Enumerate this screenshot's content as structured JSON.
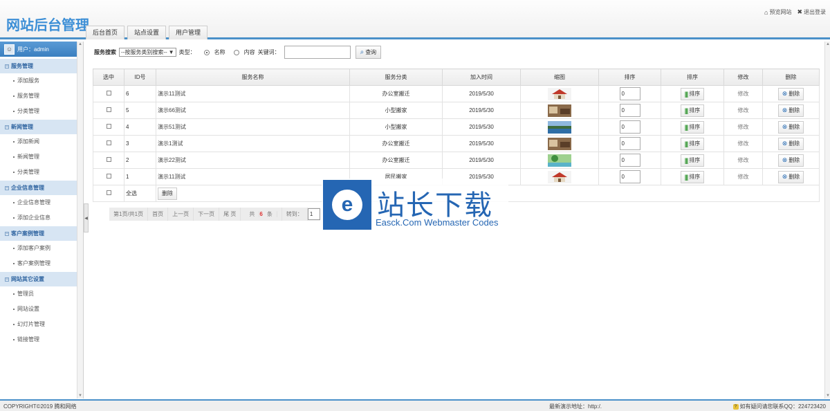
{
  "header": {
    "logo": "网站后台管理",
    "preview_site": "预览网站",
    "logout": "退出登录",
    "tabs": [
      "后台首页",
      "站点设置",
      "用户管理"
    ]
  },
  "sidebar": {
    "user_label": "用户：admin",
    "groups": [
      {
        "title": "服务管理",
        "items": [
          "添加服务",
          "服务管理",
          "分类管理"
        ]
      },
      {
        "title": "新闻管理",
        "items": [
          "添加新闻",
          "新闻管理",
          "分类管理"
        ]
      },
      {
        "title": "企业信息管理",
        "items": [
          "企业信息管理",
          "添加企业信息"
        ]
      },
      {
        "title": "客户案例管理",
        "items": [
          "添加客户案例",
          "客户案例管理"
        ]
      },
      {
        "title": "网站其它设置",
        "items": [
          "管理员",
          "网站设置",
          "幻灯片管理",
          "链接管理"
        ]
      }
    ]
  },
  "search": {
    "label": "服务搜索",
    "category_select": "--按服务类别搜索--",
    "type_label": "类型：",
    "opt_name": "名称",
    "opt_content": "内容",
    "keyword_label": "关键词：",
    "keyword_value": "",
    "query_button": "查询"
  },
  "table": {
    "headers": [
      "选中",
      "ID号",
      "服务名称",
      "服务分类",
      "加入时间",
      "缩图",
      "排序",
      "排序",
      "修改",
      "删除"
    ],
    "rows": [
      {
        "id": "6",
        "name": "演示11测试",
        "category": "办公室搬迁",
        "date": "2019/5/30",
        "thumb": "house-thumb",
        "sort": "0",
        "sort_btn": "排序",
        "edit": "修改",
        "delete": "删除"
      },
      {
        "id": "5",
        "name": "演示66测试",
        "category": "小型搬家",
        "date": "2019/5/30",
        "thumb": "room-thumb",
        "sort": "0",
        "sort_btn": "排序",
        "edit": "修改",
        "delete": "删除"
      },
      {
        "id": "4",
        "name": "演示51测试",
        "category": "小型搬家",
        "date": "2019/5/30",
        "thumb": "lake-thumb",
        "sort": "0",
        "sort_btn": "排序",
        "edit": "修改",
        "delete": "删除"
      },
      {
        "id": "3",
        "name": "演示1测试",
        "category": "办公室搬迁",
        "date": "2019/5/30",
        "thumb": "room-thumb",
        "sort": "0",
        "sort_btn": "排序",
        "edit": "修改",
        "delete": "删除"
      },
      {
        "id": "2",
        "name": "演示22测试",
        "category": "办公室搬迁",
        "date": "2019/5/30",
        "thumb": "nature-thumb",
        "sort": "0",
        "sort_btn": "排序",
        "edit": "修改",
        "delete": "删除"
      },
      {
        "id": "1",
        "name": "演示11测试",
        "category": "居民搬家",
        "date": "2019/5/30",
        "thumb": "house-thumb",
        "sort": "0",
        "sort_btn": "排序",
        "edit": "修改",
        "delete": "删除"
      }
    ],
    "select_all": "全选",
    "bulk_delete": "删除"
  },
  "pager": {
    "page_info": "第1页/共1页",
    "first": "首页",
    "prev": "上一页",
    "next": "下一页",
    "last": "尾 页",
    "total_prefix": "共",
    "total_count": "6",
    "total_suffix": "条",
    "jump_label": "转到：",
    "jump_value": "1"
  },
  "watermark": {
    "cn": "站长下载",
    "en": "Easck.Com Webmaster Codes",
    "logo_letter": "e"
  },
  "footer": {
    "copyright": "COPYRIGHT©2019 腾和网络",
    "demo": "最新演示地址：http:/.",
    "contact": "如有疑问请您联系QQ：224723420"
  },
  "colors": {
    "accent": "#4a90c9",
    "group_bg": "#d7e5f3",
    "watermark": "#2566b3"
  }
}
